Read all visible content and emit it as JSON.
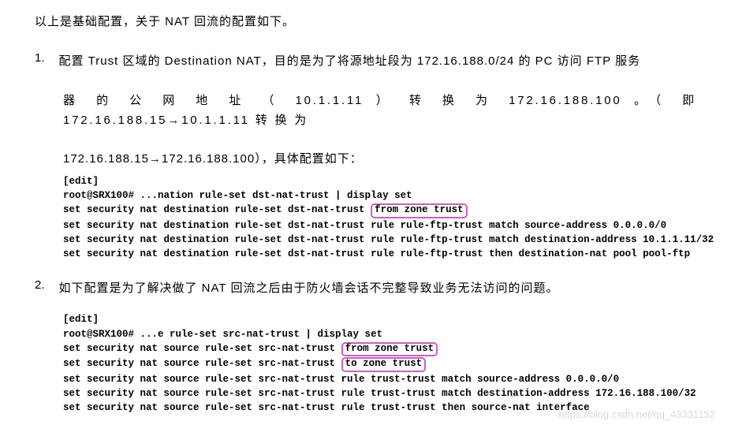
{
  "intro": "以上是基础配置，关于 NAT 回流的配置如下。",
  "item1": {
    "number": "1.",
    "line1": "配置 Trust 区域的 Destination NAT，目的是为了将源地址段为 172.16.188.0/24 的 PC 访问 FTP 服务",
    "line2": "器 的 公 网 地 址 （ 10.1.1.11 ） 转 换 为  172.16.188.100 。（ 即  172.16.188.15→10.1.1.11  转 换 为",
    "line3": "172.16.188.15→172.16.188.100），具体配置如下："
  },
  "code1": {
    "l1": "[edit]",
    "l2": "root@SRX100# ...nation rule-set dst-nat-trust | display set",
    "l3a": "set security nat destination rule-set dst-nat-trust ",
    "l3h": "from zone trust",
    "l4": "set security nat destination rule-set dst-nat-trust rule rule-ftp-trust match source-address 0.0.0.0/0",
    "l5": "set security nat destination rule-set dst-nat-trust rule rule-ftp-trust match destination-address 10.1.1.11/32",
    "l6": "set security nat destination rule-set dst-nat-trust rule rule-ftp-trust then destination-nat pool pool-ftp"
  },
  "item2": {
    "number": "2.",
    "line1": "如下配置是为了解决做了 NAT 回流之后由于防火墙会话不完整导致业务无法访问的问题。"
  },
  "code2": {
    "l1": "[edit]",
    "l2": "root@SRX100# ...e rule-set src-nat-trust | display set",
    "l3a": "set security nat source rule-set src-nat-trust ",
    "l3h": "from zone trust",
    "l4a": "set security nat source rule-set src-nat-trust ",
    "l4h": "to zone trust",
    "l5": "set security nat source rule-set src-nat-trust rule trust-trust match source-address 0.0.0.0/0",
    "l6": "set security nat source rule-set src-nat-trust rule trust-trust match destination-address 172.16.188.100/32",
    "l7": "set security nat source rule-set src-nat-trust rule trust-trust then source-nat interface"
  },
  "watermark": "https://blog.csdn.net/qq_43331152"
}
